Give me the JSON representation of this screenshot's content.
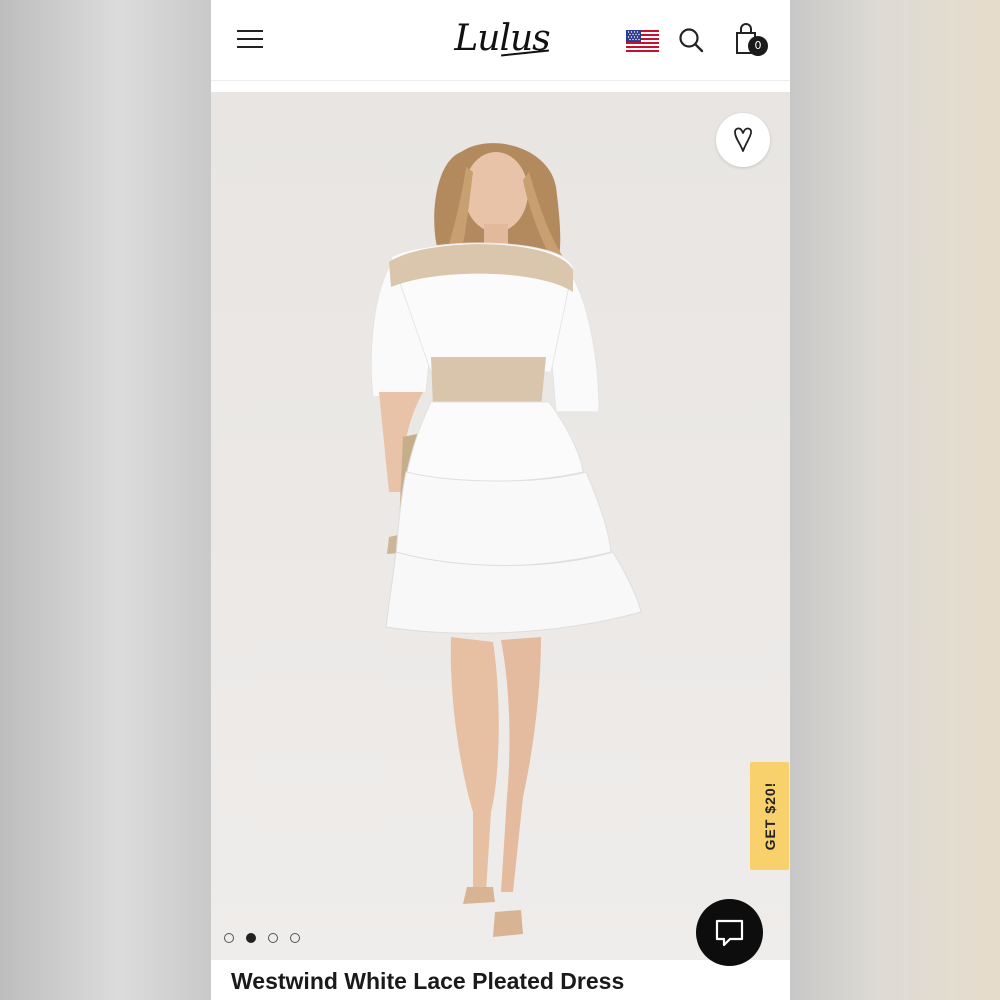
{
  "header": {
    "logo_text": "Lulus",
    "cart_count": "0"
  },
  "product": {
    "title": "Westwind White Lace Pleated Dress",
    "image_count": 4,
    "active_image_index": 1
  },
  "promo": {
    "label": "GET $20!"
  },
  "icons": {
    "menu": "hamburger-menu-icon",
    "flag": "us-flag-icon",
    "search": "search-icon",
    "cart": "shopping-bag-icon",
    "favorite": "heart-icon",
    "chat": "chat-bubble-icon"
  },
  "colors": {
    "promo_bg": "#f8d16d",
    "chat_bg": "#0d0d0d",
    "text": "#1a1a1a"
  }
}
